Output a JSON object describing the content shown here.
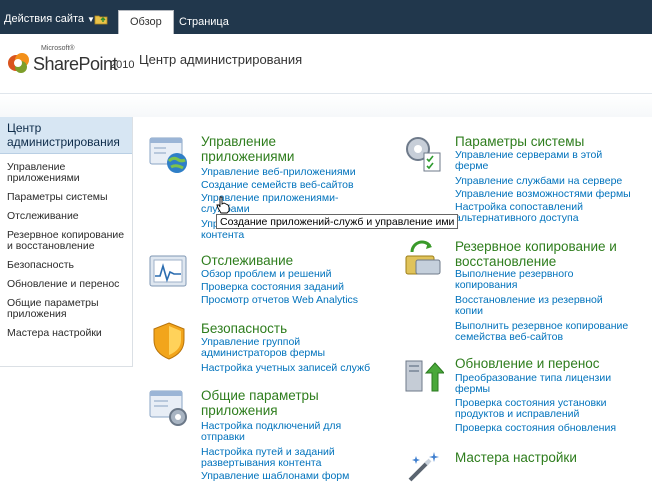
{
  "ribbon": {
    "site_actions": "Действия сайта",
    "tabs": [
      "Обзор",
      "Страница"
    ]
  },
  "header": {
    "logo_microsoft": "Microsoft®",
    "logo_product": "SharePoint",
    "logo_year": "2010",
    "title": "Центр администрирования"
  },
  "leftnav": {
    "heading": "Центр администрирования",
    "items": [
      "Управление приложениями",
      "Параметры системы",
      "Отслеживание",
      "Резервное копирование и восстановление",
      "Безопасность",
      "Обновление и перенос",
      "Общие параметры приложения",
      "Мастера настройки"
    ]
  },
  "sections": {
    "app_management": {
      "heading": "Управление приложениями",
      "links": [
        "Управление веб-приложениями",
        "Создание семейств веб-сайтов",
        "Управление приложениями-службами",
        "Управление базами данных контента"
      ]
    },
    "monitoring": {
      "heading": "Отслеживание",
      "links": [
        "Обзор проблем и решений",
        "Проверка состояния заданий",
        "Просмотр отчетов Web Analytics"
      ]
    },
    "security": {
      "heading": "Безопасность",
      "links": [
        "Управление группой администраторов фермы",
        "Настройка учетных записей служб"
      ]
    },
    "general_settings": {
      "heading": "Общие параметры приложения",
      "links": [
        "Настройка подключений для отправки",
        "Настройка путей и заданий развертывания контента",
        "Управление шаблонами форм"
      ]
    },
    "system_settings": {
      "heading": "Параметры системы",
      "links": [
        "Управление серверами в этой ферме",
        "Управление службами на сервере",
        "Управление возможностями фермы",
        "Настройка сопоставлений альтернативного доступа"
      ]
    },
    "backup": {
      "heading": "Резервное копирование и восстановление",
      "links": [
        "Выполнение резервного копирования",
        "Восстановление из резервной копии",
        "Выполнить резервное копирование семейства веб-сайтов"
      ]
    },
    "upgrade": {
      "heading": "Обновление и перенос",
      "links": [
        "Преобразование типа лицензии фермы",
        "Проверка состояния установки продуктов и исправлений",
        "Проверка состояния обновления"
      ]
    },
    "wizards": {
      "heading": "Мастера настройки"
    }
  },
  "tooltip": "Создание приложений-служб и управление ими"
}
